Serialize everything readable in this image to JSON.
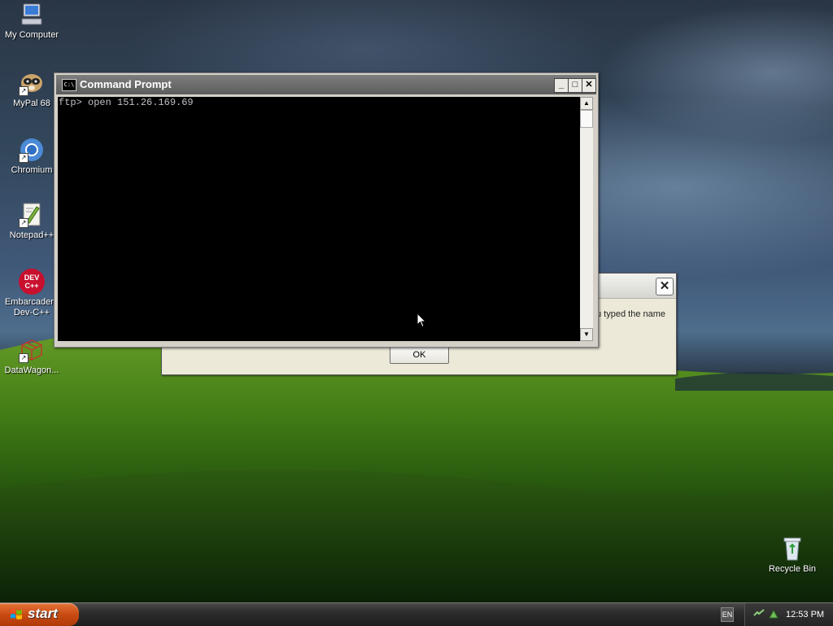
{
  "desktop": {
    "icons": [
      {
        "label": "My Computer",
        "icon": "computer-icon"
      },
      {
        "label": "MyPal 68",
        "icon": "mypal-icon"
      },
      {
        "label": "Chromium",
        "icon": "chromium-icon"
      },
      {
        "label": "Notepad++",
        "icon": "notepadpp-icon"
      },
      {
        "label_line1": "Embarcadero",
        "label_line2": "Dev-C++",
        "icon_text_top": "DEV",
        "icon_text_bottom": "C++",
        "icon": "devcpp-icon"
      },
      {
        "label": "DataWagon...",
        "icon": "datawagon-icon"
      },
      {
        "label": "Recycle Bin",
        "icon": "recycle-bin-icon"
      }
    ]
  },
  "dialog": {
    "close_glyph": "✕",
    "message_fragment": "u typed the name",
    "ok_label": "OK"
  },
  "cmd_window": {
    "title": "Command Prompt",
    "icon_text": "C:\\",
    "minimize_glyph": "_",
    "maximize_glyph": "□",
    "close_glyph": "✕",
    "console_text": "ftp> open 151.26.169.69",
    "scroll_up_glyph": "▲",
    "scroll_down_glyph": "▼"
  },
  "taskbar": {
    "start_label": "start",
    "language": "EN",
    "clock": "12:53 PM"
  },
  "colors": {
    "console_bg": "#000000",
    "console_fg": "#c0c0c0",
    "start_orange": "#c84a12",
    "titlebar_gray": "#6a6a6a"
  }
}
